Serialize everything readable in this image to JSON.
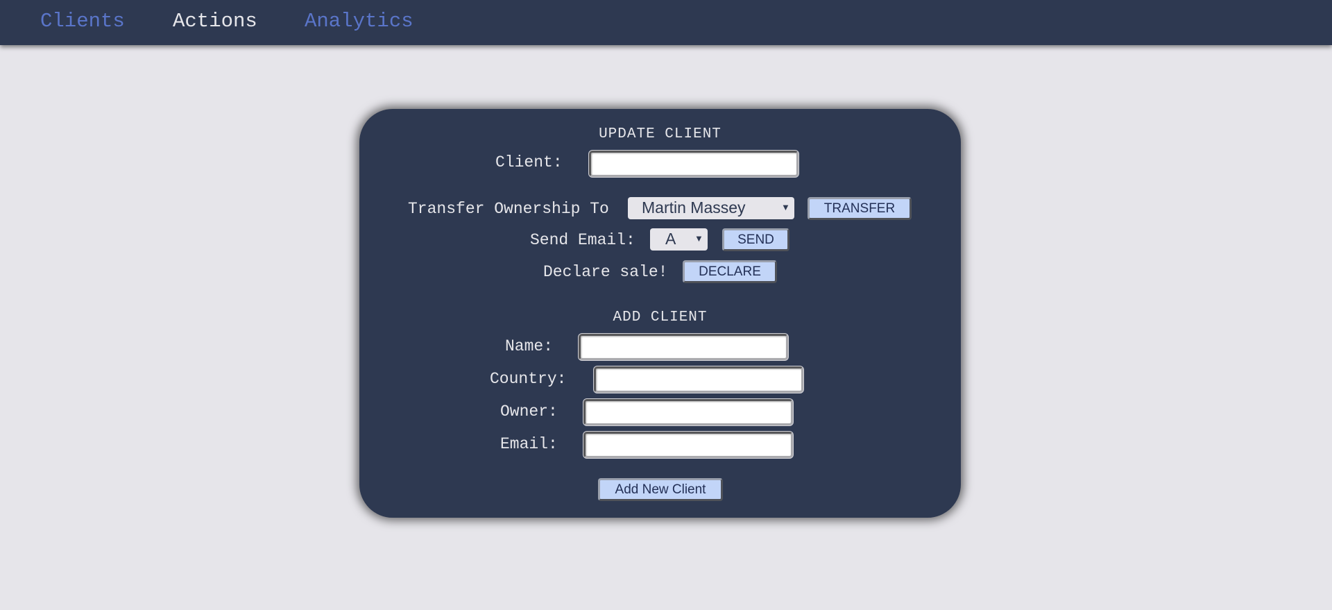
{
  "nav": {
    "clients": "Clients",
    "actions": "Actions",
    "analytics": "Analytics"
  },
  "update_client": {
    "heading": "UPDATE CLIENT",
    "client_label": "Client:",
    "client_value": "",
    "transfer_label": "Transfer Ownership To",
    "transfer_selected": "Martin Massey",
    "transfer_button": "TRANSFER",
    "email_label": "Send Email:",
    "email_selected": "A",
    "send_button": "SEND",
    "declare_label": "Declare sale!",
    "declare_button": "DECLARE"
  },
  "add_client": {
    "heading": "ADD CLIENT",
    "name_label": "Name:",
    "country_label": "Country:",
    "owner_label": "Owner:",
    "email_label": "Email:",
    "name_value": "",
    "country_value": "",
    "owner_value": "",
    "email_value": "",
    "submit_button": "Add New Client"
  },
  "colors": {
    "background": "#e6e5ea",
    "panel": "#2e3951",
    "nav_link": "#5a75c9",
    "nav_active": "#e6e6ea",
    "button": "#c2d5f8"
  },
  "icons": {
    "select_arrow": "triangle-down"
  }
}
